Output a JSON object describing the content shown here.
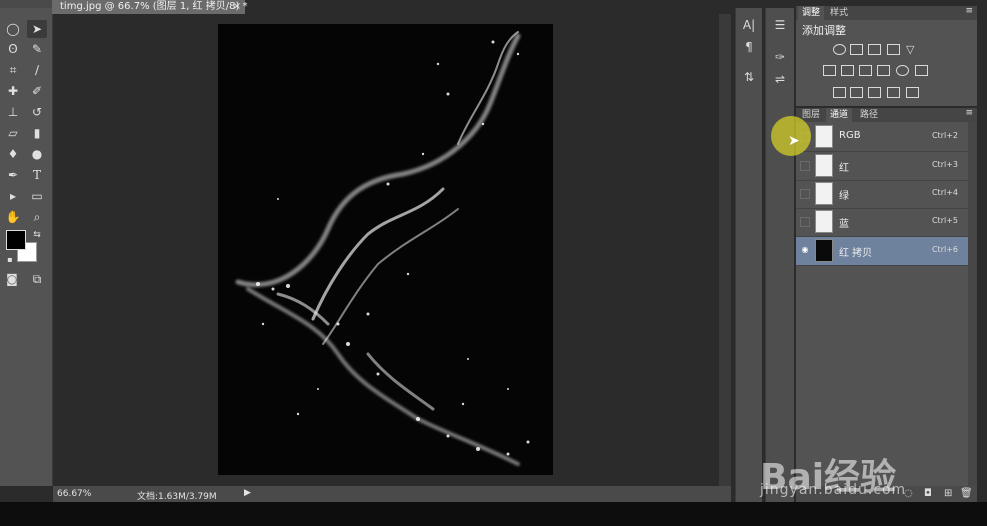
{
  "document": {
    "tab_title": "timg.jpg @ 66.7% (图层 1, 红 拷贝/8) *",
    "close_glyph": "×"
  },
  "status": {
    "zoom": "66.67%",
    "doc_info": "文档:1.63M/3.79M"
  },
  "adjustments_panel": {
    "tabs": [
      "调整",
      "样式"
    ],
    "selected_tab": "调整",
    "heading": "添加调整",
    "icons": [
      "brightness-icon",
      "levels-icon",
      "curves-icon",
      "exposure-icon",
      "vibrance-icon",
      "hue-saturation-icon",
      "color-balance-icon",
      "black-white-icon",
      "photo-filter-icon",
      "channel-mixer-icon",
      "color-lookup-icon",
      "invert-icon",
      "posterize-icon",
      "threshold-icon",
      "selective-color-icon",
      "gradient-map-icon"
    ]
  },
  "channels_panel": {
    "tabs": [
      "图层",
      "通道",
      "路径"
    ],
    "selected_tab": "通道",
    "channels": [
      {
        "name": "RGB",
        "shortcut": "Ctrl+2",
        "visible": false,
        "thumb": "light"
      },
      {
        "name": "红",
        "shortcut": "Ctrl+3",
        "visible": false,
        "thumb": "light"
      },
      {
        "name": "绿",
        "shortcut": "Ctrl+4",
        "visible": false,
        "thumb": "light"
      },
      {
        "name": "蓝",
        "shortcut": "Ctrl+5",
        "visible": false,
        "thumb": "light"
      },
      {
        "name": "红 拷贝",
        "shortcut": "Ctrl+6",
        "visible": true,
        "thumb": "dark",
        "selected": true
      }
    ]
  },
  "toolbox": {
    "tools": [
      "marquee-tool-icon",
      "move-tool-icon",
      "lasso-tool-icon",
      "quick-select-tool-icon",
      "crop-tool-icon",
      "eyedropper-tool-icon",
      "healing-tool-icon",
      "brush-tool-icon",
      "stamp-tool-icon",
      "history-brush-tool-icon",
      "eraser-tool-icon",
      "gradient-tool-icon",
      "blur-tool-icon",
      "dodge-tool-icon",
      "pen-tool-icon",
      "type-tool-icon",
      "path-select-tool-icon",
      "shape-tool-icon",
      "hand-tool-icon",
      "zoom-tool-icon"
    ],
    "foreground_color": "#000000",
    "background_color": "#ffffff"
  },
  "watermark": {
    "brand": "Bai经验",
    "url": "jingyan.baidu.com"
  },
  "colors": {
    "selected_row": "#6e819d",
    "panel_bg": "#535353",
    "workspace_bg": "#2b2b2b"
  }
}
